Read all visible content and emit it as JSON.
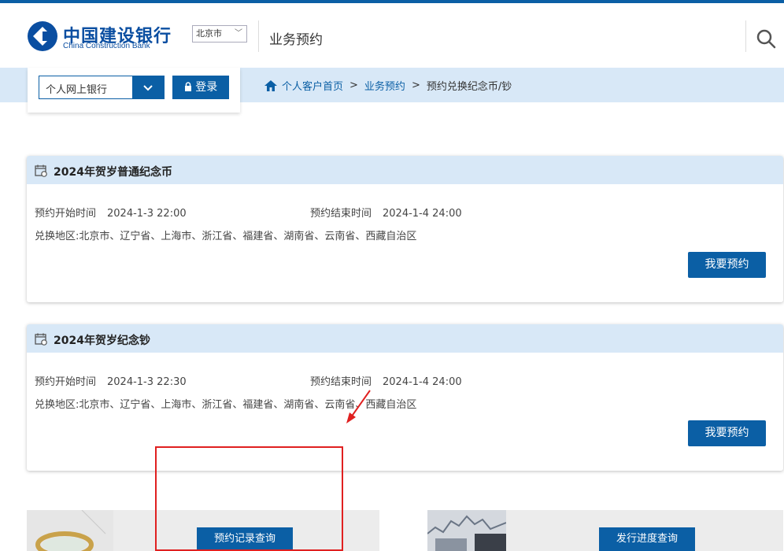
{
  "header": {
    "logo_cn": "中国建设银行",
    "logo_en": "China Construction Bank",
    "city": "北京市",
    "section_title": "业务预约"
  },
  "login": {
    "bank_select": "个人网上银行",
    "login_label": "登录"
  },
  "breadcrumb": {
    "home": "个人客户首页",
    "sep1": ">",
    "level2": "业务预约",
    "sep2": ">",
    "current": "预约兑换纪念币/钞"
  },
  "cards": [
    {
      "title": "2024年贺岁普通纪念币",
      "start_label": "预约开始时间",
      "start_value": "2024-1-3 22:00",
      "end_label": "预约结束时间",
      "end_value": "2024-1-4 24:00",
      "region_label": "兑换地区:",
      "region_value": "北京市、辽宁省、上海市、浙江省、福建省、湖南省、云南省、西藏自治区",
      "button": "我要预约"
    },
    {
      "title": "2024年贺岁纪念钞",
      "start_label": "预约开始时间",
      "start_value": "2024-1-3 22:30",
      "end_label": "预约结束时间",
      "end_value": "2024-1-4 24:00",
      "region_label": "兑换地区:",
      "region_value": "北京市、辽宁省、上海市、浙江省、福建省、湖南省、云南省、西藏自治区",
      "button": "我要预约"
    }
  ],
  "bottom": {
    "record_query": "预约记录查询",
    "progress_query": "发行进度查询"
  },
  "colors": {
    "brand_blue": "#0b5fa5",
    "nav_bg": "#d8e8f7",
    "annotation_red": "#e02020"
  },
  "icons": {
    "logo": "ccb-logo-icon",
    "search": "search-icon",
    "home": "home-icon",
    "calendar": "calendar-icon",
    "lock": "lock-icon",
    "dropdown": "chevron-down-icon"
  }
}
